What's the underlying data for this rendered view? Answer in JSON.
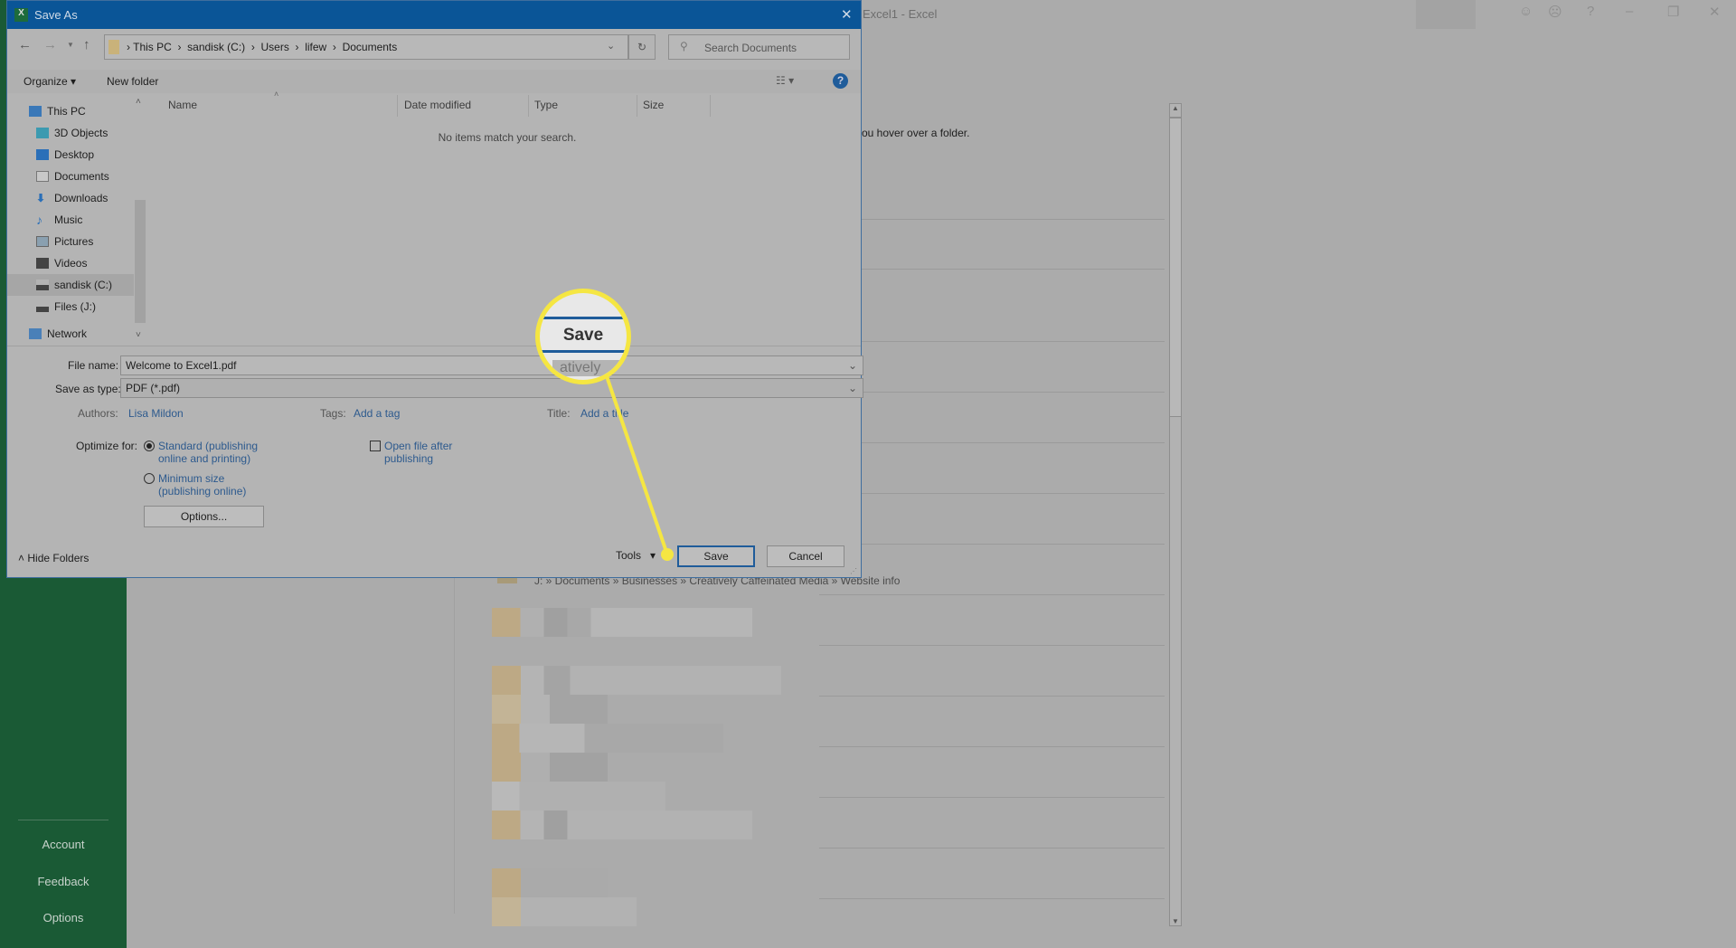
{
  "excel": {
    "title": "Excel1 - Excel",
    "hint": "ou hover over a folder.",
    "path": "J: » Documents » Businesses » Creatively Caffeinated Media » Website info",
    "sidebar": [
      {
        "label": "Account"
      },
      {
        "label": "Feedback"
      },
      {
        "label": "Options"
      }
    ]
  },
  "dialog": {
    "title": "Save As",
    "breadcrumb": [
      "This PC",
      "sandisk (C:)",
      "Users",
      "lifew",
      "Documents"
    ],
    "search_placeholder": "Search Documents",
    "organize": "Organize",
    "new_folder": "New folder",
    "nav": [
      {
        "label": "This PC",
        "icon": "computer-icon"
      },
      {
        "label": "3D Objects",
        "icon": "cube-icon"
      },
      {
        "label": "Desktop",
        "icon": "desktop-icon"
      },
      {
        "label": "Documents",
        "icon": "document-icon"
      },
      {
        "label": "Downloads",
        "icon": "download-icon"
      },
      {
        "label": "Music",
        "icon": "music-icon"
      },
      {
        "label": "Pictures",
        "icon": "picture-icon"
      },
      {
        "label": "Videos",
        "icon": "video-icon"
      },
      {
        "label": "sandisk (C:)",
        "icon": "drive-icon",
        "selected": true
      },
      {
        "label": "Files (J:)",
        "icon": "drive-icon"
      },
      {
        "label": "Network",
        "icon": "network-icon"
      }
    ],
    "columns": [
      "Name",
      "Date modified",
      "Type",
      "Size"
    ],
    "empty": "No items match your search.",
    "file_name_label": "File name:",
    "file_name": "Welcome to Excel1.pdf",
    "type_label": "Save as type:",
    "type": "PDF (*.pdf)",
    "authors_label": "Authors:",
    "authors": "Lisa Mildon",
    "tags_label": "Tags:",
    "tags": "Add a tag",
    "title_label": "Title:",
    "title_value": "Add a title",
    "optimize_label": "Optimize for:",
    "opt_standard": "Standard (publishing",
    "opt_standard2": "online and printing)",
    "opt_min": "Minimum size",
    "opt_min2": "(publishing online)",
    "open_after": "Open file after",
    "open_after2": "publishing",
    "open_after_checked": false,
    "options": "Options...",
    "hide_folders": "Hide Folders",
    "tools": "Tools",
    "save": "Save",
    "cancel": "Cancel"
  },
  "callout": {
    "label": "Save",
    "under": "atively",
    "color": "#f5e642"
  }
}
